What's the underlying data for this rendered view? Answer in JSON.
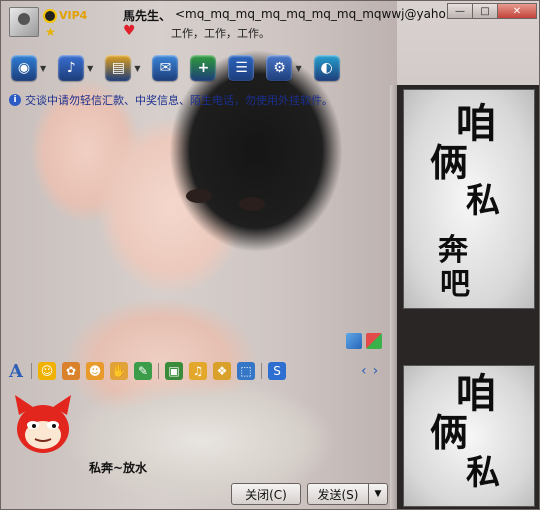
{
  "titlebar": {
    "vip_label": "VIP4",
    "contact_name": "馬先生、",
    "contact_email": "<mq_mq_mq_mq_mq_mq_mq_mqwwj@yaho...",
    "status_text": "工作，工作，工作。",
    "minimize_glyph": "—",
    "maximize_glyph": "□",
    "close_glyph": "✕"
  },
  "toolbar": {
    "items": [
      {
        "name": "video-call",
        "icon": "webcam-icon",
        "glyph": "◉",
        "color": "#2f7fd6",
        "has_dropdown": true
      },
      {
        "name": "voice-call",
        "icon": "microphone-icon",
        "glyph": "♪",
        "color": "#3a6fd1",
        "has_dropdown": true
      },
      {
        "name": "send-file",
        "icon": "folder-icon",
        "glyph": "▤",
        "color": "#e2a21e",
        "has_dropdown": true
      },
      {
        "name": "send-message",
        "icon": "envelope-icon",
        "glyph": "✉",
        "color": "#3b86d9",
        "has_dropdown": false
      },
      {
        "name": "create-group",
        "icon": "add-group-icon",
        "glyph": "+",
        "color": "#2f9d3a",
        "has_dropdown": false
      },
      {
        "name": "remote-assist",
        "icon": "remote-desktop-icon",
        "glyph": "☰",
        "color": "#2b64bf",
        "has_dropdown": false
      },
      {
        "name": "app-menu",
        "icon": "apps-icon",
        "glyph": "⚙",
        "color": "#4a78c9",
        "has_dropdown": true
      },
      {
        "name": "explore",
        "icon": "globe-icon",
        "glyph": "◐",
        "color": "#26a0cf",
        "has_dropdown": false
      }
    ]
  },
  "notice": {
    "text": "交谈中请勿轻信汇款、中奖信息、陌生电话，勿使用外挂软件。"
  },
  "format_toolbar": {
    "items": [
      {
        "icon": "font-icon",
        "glyph": "A",
        "color": "#2d5fb9"
      },
      {
        "icon": "smiley-icon",
        "glyph": "☺",
        "color": "#f0b100"
      },
      {
        "icon": "magic-emoticon-icon",
        "glyph": "✿",
        "color": "#d9812b"
      },
      {
        "icon": "face-icon",
        "glyph": "☻",
        "color": "#e89b2b"
      },
      {
        "icon": "thumbs-up-icon",
        "glyph": "✋",
        "color": "#e2a23a"
      },
      {
        "icon": "doodle-icon",
        "glyph": "✎",
        "color": "#3b9c4a"
      },
      {
        "icon": "image-icon",
        "glyph": "▣",
        "color": "#3b8c3a"
      },
      {
        "icon": "music-icon",
        "glyph": "♫",
        "color": "#e3a72b"
      },
      {
        "icon": "gift-icon",
        "glyph": "❖",
        "color": "#d9a12a"
      },
      {
        "icon": "screenshot-icon",
        "glyph": "⬚",
        "color": "#3676c7"
      },
      {
        "icon": "sogou-icon",
        "glyph": "S",
        "color": "#2d6fd0"
      }
    ]
  },
  "composer": {
    "text": "私奔~放水"
  },
  "buttons": {
    "close_label": "关闭(C)",
    "send_label": "发送(S)",
    "dropdown_glyph": "▼"
  },
  "right_panel": {
    "card_one_chars": [
      "咱",
      "俩",
      "私",
      "奔",
      "吧"
    ],
    "card_two_chars": [
      "咱",
      "俩",
      "私"
    ]
  },
  "colors": {
    "accent": "#2d5fb9",
    "notice_text": "#1b2f8e"
  }
}
